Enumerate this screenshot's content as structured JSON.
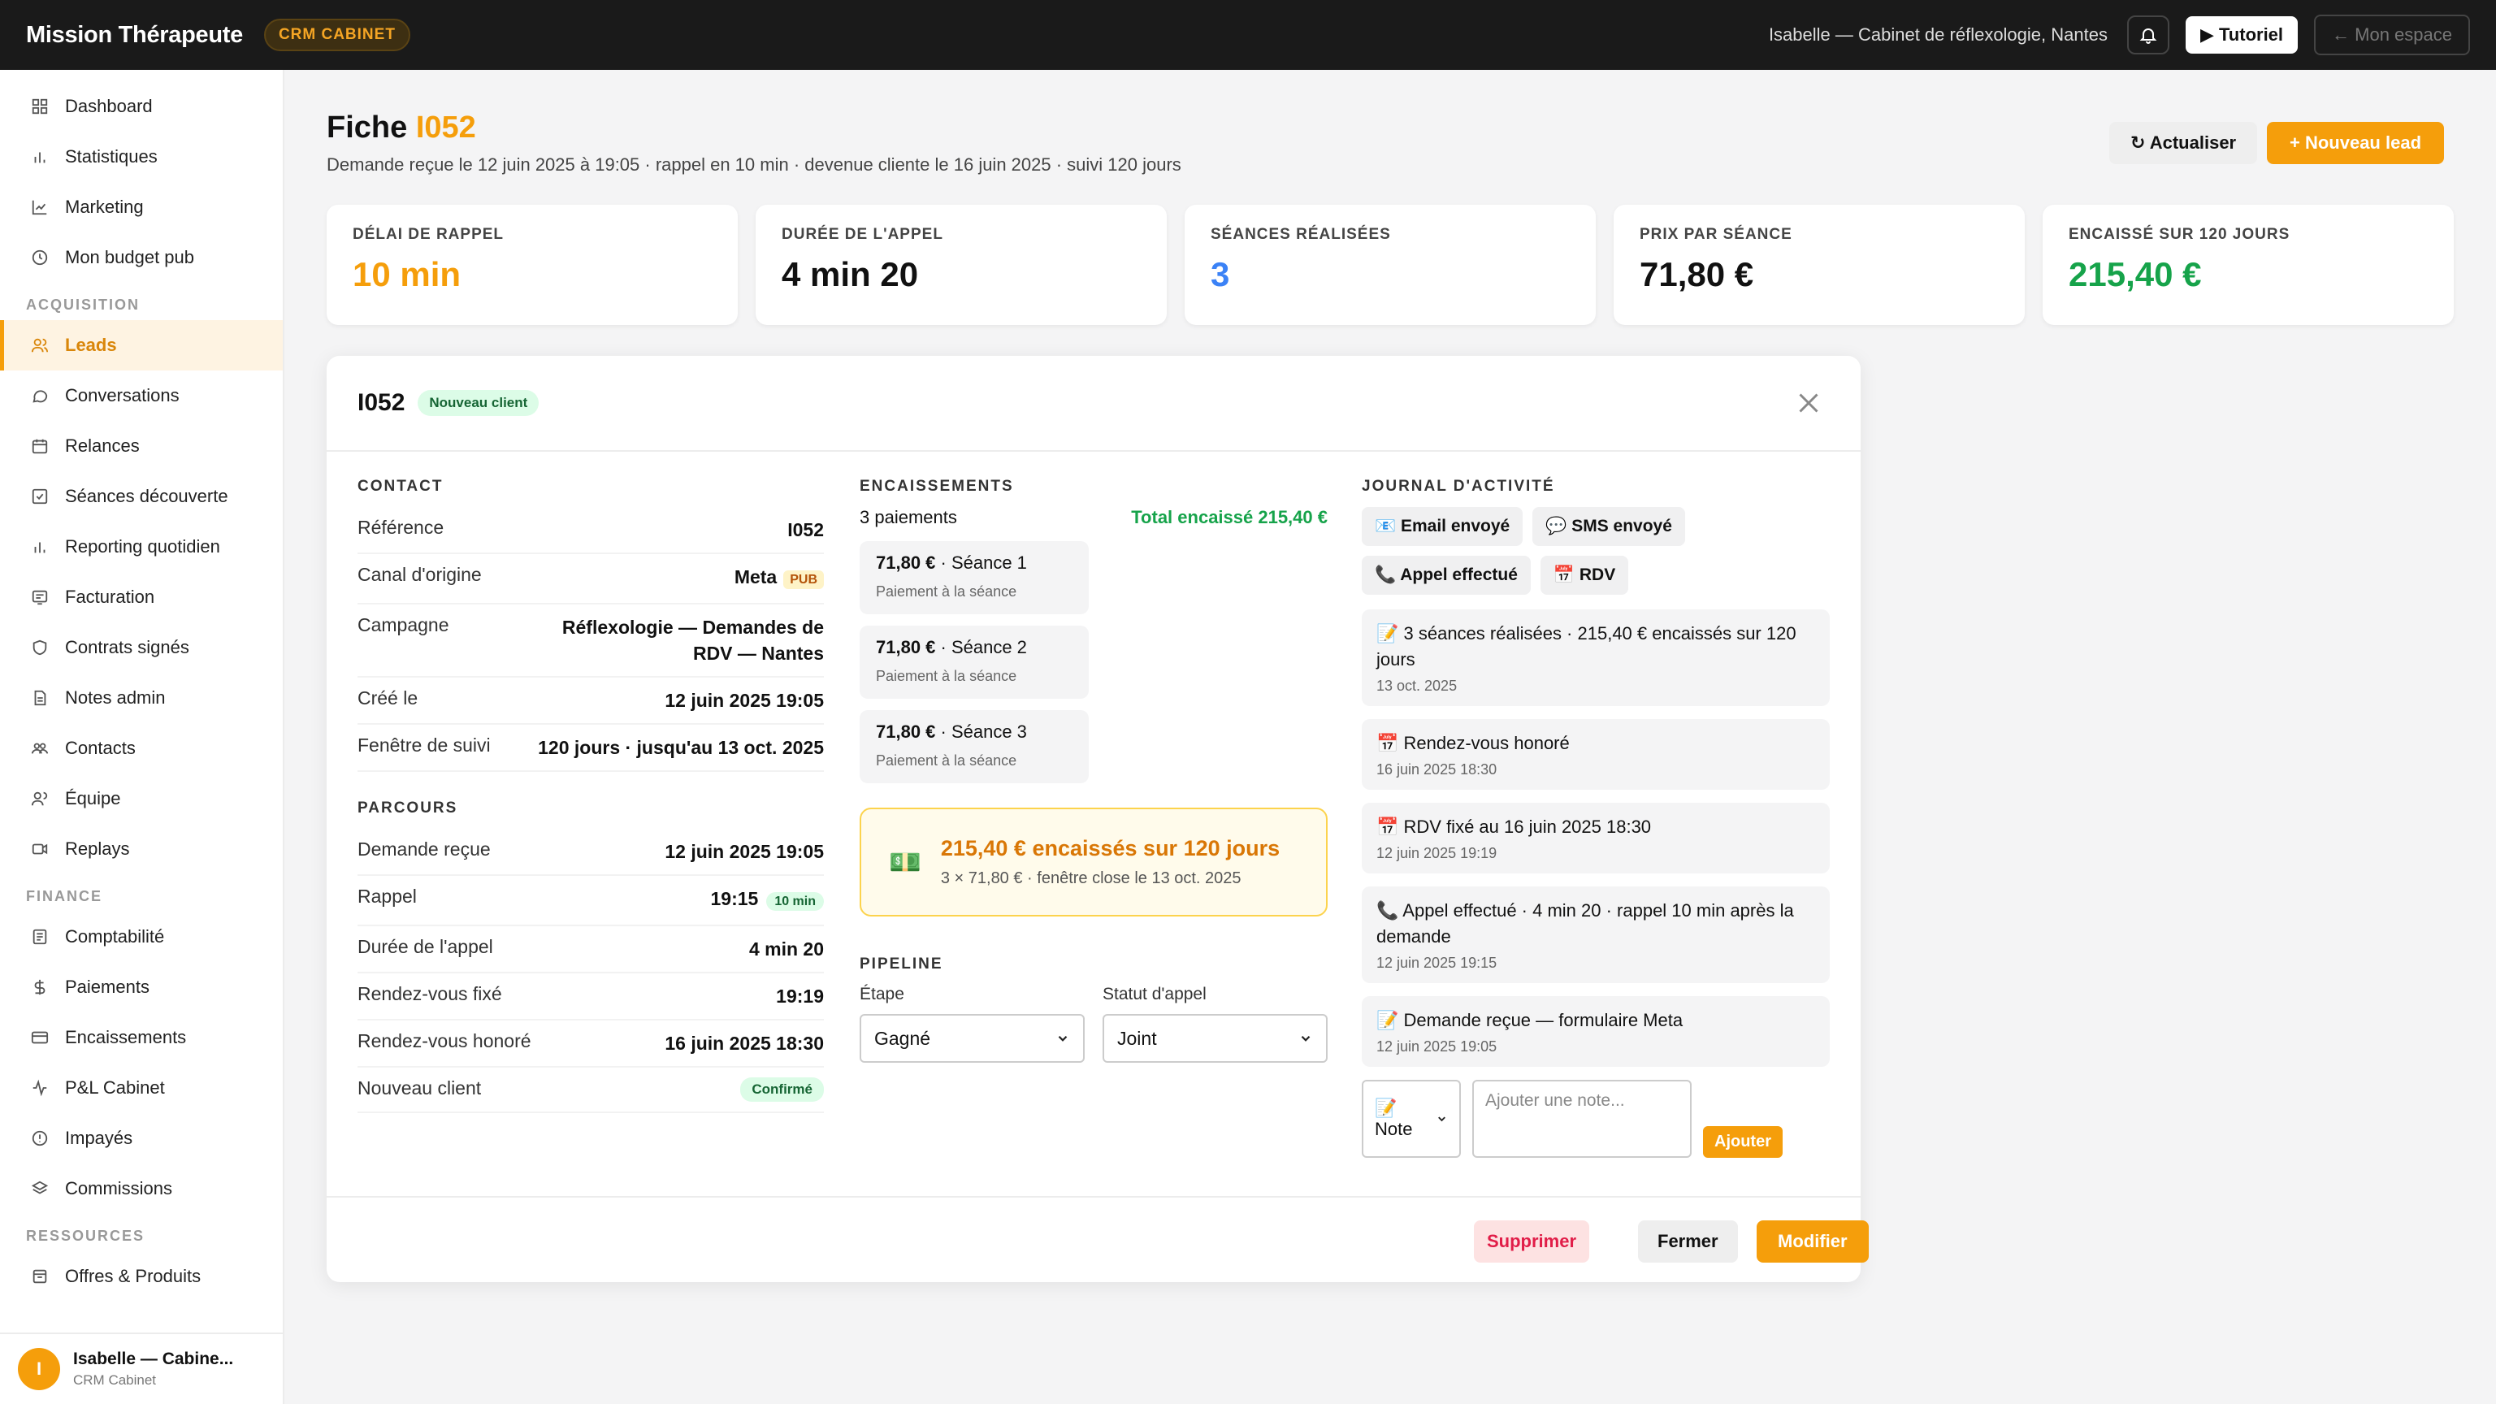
{
  "topbar": {
    "brand": "Mission Thérapeute",
    "badge": "CRM CABINET",
    "user": "Isabelle — Cabinet de réflexologie, Nantes",
    "tutorial": "▶ Tutoriel",
    "my_space": "← Mon espace"
  },
  "sidebar": {
    "items_top": [
      {
        "label": "Dashboard",
        "icon": "grid-icon"
      },
      {
        "label": "Statistiques",
        "icon": "bar-chart-icon"
      },
      {
        "label": "Marketing",
        "icon": "line-chart-icon"
      },
      {
        "label": "Mon budget pub",
        "icon": "clock-icon"
      }
    ],
    "section_acquisition": "ACQUISITION",
    "items_acq": [
      {
        "label": "Leads",
        "icon": "users-icon"
      },
      {
        "label": "Conversations",
        "icon": "chat-icon"
      },
      {
        "label": "Relances",
        "icon": "calendar-icon"
      },
      {
        "label": "Séances découverte",
        "icon": "checkbox-icon"
      },
      {
        "label": "Reporting quotidien",
        "icon": "bar-chart-icon"
      },
      {
        "label": "Facturation",
        "icon": "receipt-icon"
      },
      {
        "label": "Contrats signés",
        "icon": "shield-icon"
      },
      {
        "label": "Notes admin",
        "icon": "document-icon"
      },
      {
        "label": "Contacts",
        "icon": "contacts-icon"
      },
      {
        "label": "Équipe",
        "icon": "team-icon"
      },
      {
        "label": "Replays",
        "icon": "video-icon"
      }
    ],
    "section_finance": "FINANCE",
    "items_fin": [
      {
        "label": "Comptabilité",
        "icon": "ledger-icon"
      },
      {
        "label": "Paiements",
        "icon": "dollar-icon"
      },
      {
        "label": "Encaissements",
        "icon": "card-icon"
      },
      {
        "label": "P&L Cabinet",
        "icon": "pulse-icon"
      },
      {
        "label": "Impayés",
        "icon": "alert-circle-icon"
      },
      {
        "label": "Commissions",
        "icon": "layers-icon"
      }
    ],
    "section_resources": "RESSOURCES",
    "items_res": [
      {
        "label": "Offres & Produits",
        "icon": "box-icon"
      }
    ],
    "footer": {
      "initial": "I",
      "name": "Isabelle — Cabine...",
      "role": "CRM Cabinet"
    }
  },
  "page": {
    "title_prefix": "Fiche ",
    "title_ref": "I052",
    "subtitle": "Demande reçue le 12 juin 2025 à 19:05 · rappel en 10 min · devenue cliente le 16 juin 2025 · suivi 120 jours",
    "refresh": "↻ Actualiser",
    "new_lead": "+ Nouveau lead"
  },
  "stats": [
    {
      "label": "DÉLAI DE RAPPEL",
      "value": "10 min",
      "color": "#f59e0b"
    },
    {
      "label": "DURÉE DE L'APPEL",
      "value": "4 min 20",
      "color": "#111111"
    },
    {
      "label": "SÉANCES RÉALISÉES",
      "value": "3",
      "color": "#3b82f6"
    },
    {
      "label": "PRIX PAR SÉANCE",
      "value": "71,80 €",
      "color": "#111111"
    },
    {
      "label": "ENCAISSÉ SUR 120 JOURS",
      "value": "215,40 €",
      "color": "#16a34a"
    }
  ],
  "panel": {
    "id": "I052",
    "badge": "Nouveau client",
    "contact": {
      "heading": "CONTACT",
      "reference_k": "Référence",
      "reference_v": "I052",
      "canal_k": "Canal d'origine",
      "canal_v": "Meta",
      "canal_tag": "PUB",
      "campagne_k": "Campagne",
      "campagne_v": "Réflexologie — Demandes de RDV — Nantes",
      "cree_k": "Créé le",
      "cree_v": "12 juin 2025 19:05",
      "fenetre_k": "Fenêtre de suivi",
      "fenetre_v": "120 jours · jusqu'au 13 oct. 2025"
    },
    "parcours": {
      "heading": "PARCOURS",
      "demande_k": "Demande reçue",
      "demande_v": "12 juin 2025 19:05",
      "rappel_k": "Rappel",
      "rappel_v": "19:15",
      "rappel_tag": "10 min",
      "duree_k": "Durée de l'appel",
      "duree_v": "4 min 20",
      "rdv_fixe_k": "Rendez-vous fixé",
      "rdv_fixe_v": "19:19",
      "rdv_hon_k": "Rendez-vous honoré",
      "rdv_hon_v": "16 juin 2025 18:30",
      "nc_k": "Nouveau client",
      "nc_v": "Confirmé"
    },
    "encaissements": {
      "heading": "ENCAISSEMENTS",
      "count": "3 paiements",
      "total": "Total encaissé 215,40 €",
      "payments": [
        {
          "amount": "71,80 €",
          "label": " · Séance 1",
          "sub": "Paiement à la séance"
        },
        {
          "amount": "71,80 €",
          "label": " · Séance 2",
          "sub": "Paiement à la séance"
        },
        {
          "amount": "71,80 €",
          "label": " · Séance 3",
          "sub": "Paiement à la séance"
        }
      ],
      "hero_emoji": "💵",
      "hero_title": "215,40 € encaissés sur 120 jours",
      "hero_sub": "3 × 71,80 € · fenêtre close le 13 oct. 2025"
    },
    "pipeline": {
      "heading": "PIPELINE",
      "etape_label": "Étape",
      "etape_value": "Gagné",
      "statut_label": "Statut d'appel",
      "statut_value": "Joint"
    },
    "journal": {
      "heading": "JOURNAL D'ACTIVITÉ",
      "chips": [
        "📧 Email envoyé",
        "💬 SMS envoyé",
        "📞 Appel effectué",
        "📅 RDV"
      ],
      "entries": [
        {
          "text": "📝 3 séances réalisées · 215,40 € encaissés sur 120 jours",
          "date": "13 oct. 2025"
        },
        {
          "text": "📅 Rendez-vous honoré",
          "date": "16 juin 2025 18:30"
        },
        {
          "text": "📅 RDV fixé au 16 juin 2025 18:30",
          "date": "12 juin 2025 19:19"
        },
        {
          "text": "📞 Appel effectué · 4 min 20 · rappel 10 min après la demande",
          "date": "12 juin 2025 19:15"
        },
        {
          "text": "📝 Demande reçue — formulaire Meta",
          "date": "12 juin 2025 19:05"
        }
      ],
      "note_type": "📝 Note",
      "note_placeholder": "Ajouter une note...",
      "add": "Ajouter"
    },
    "footer": {
      "delete": "Supprimer",
      "close": "Fermer",
      "edit": "Modifier"
    }
  }
}
